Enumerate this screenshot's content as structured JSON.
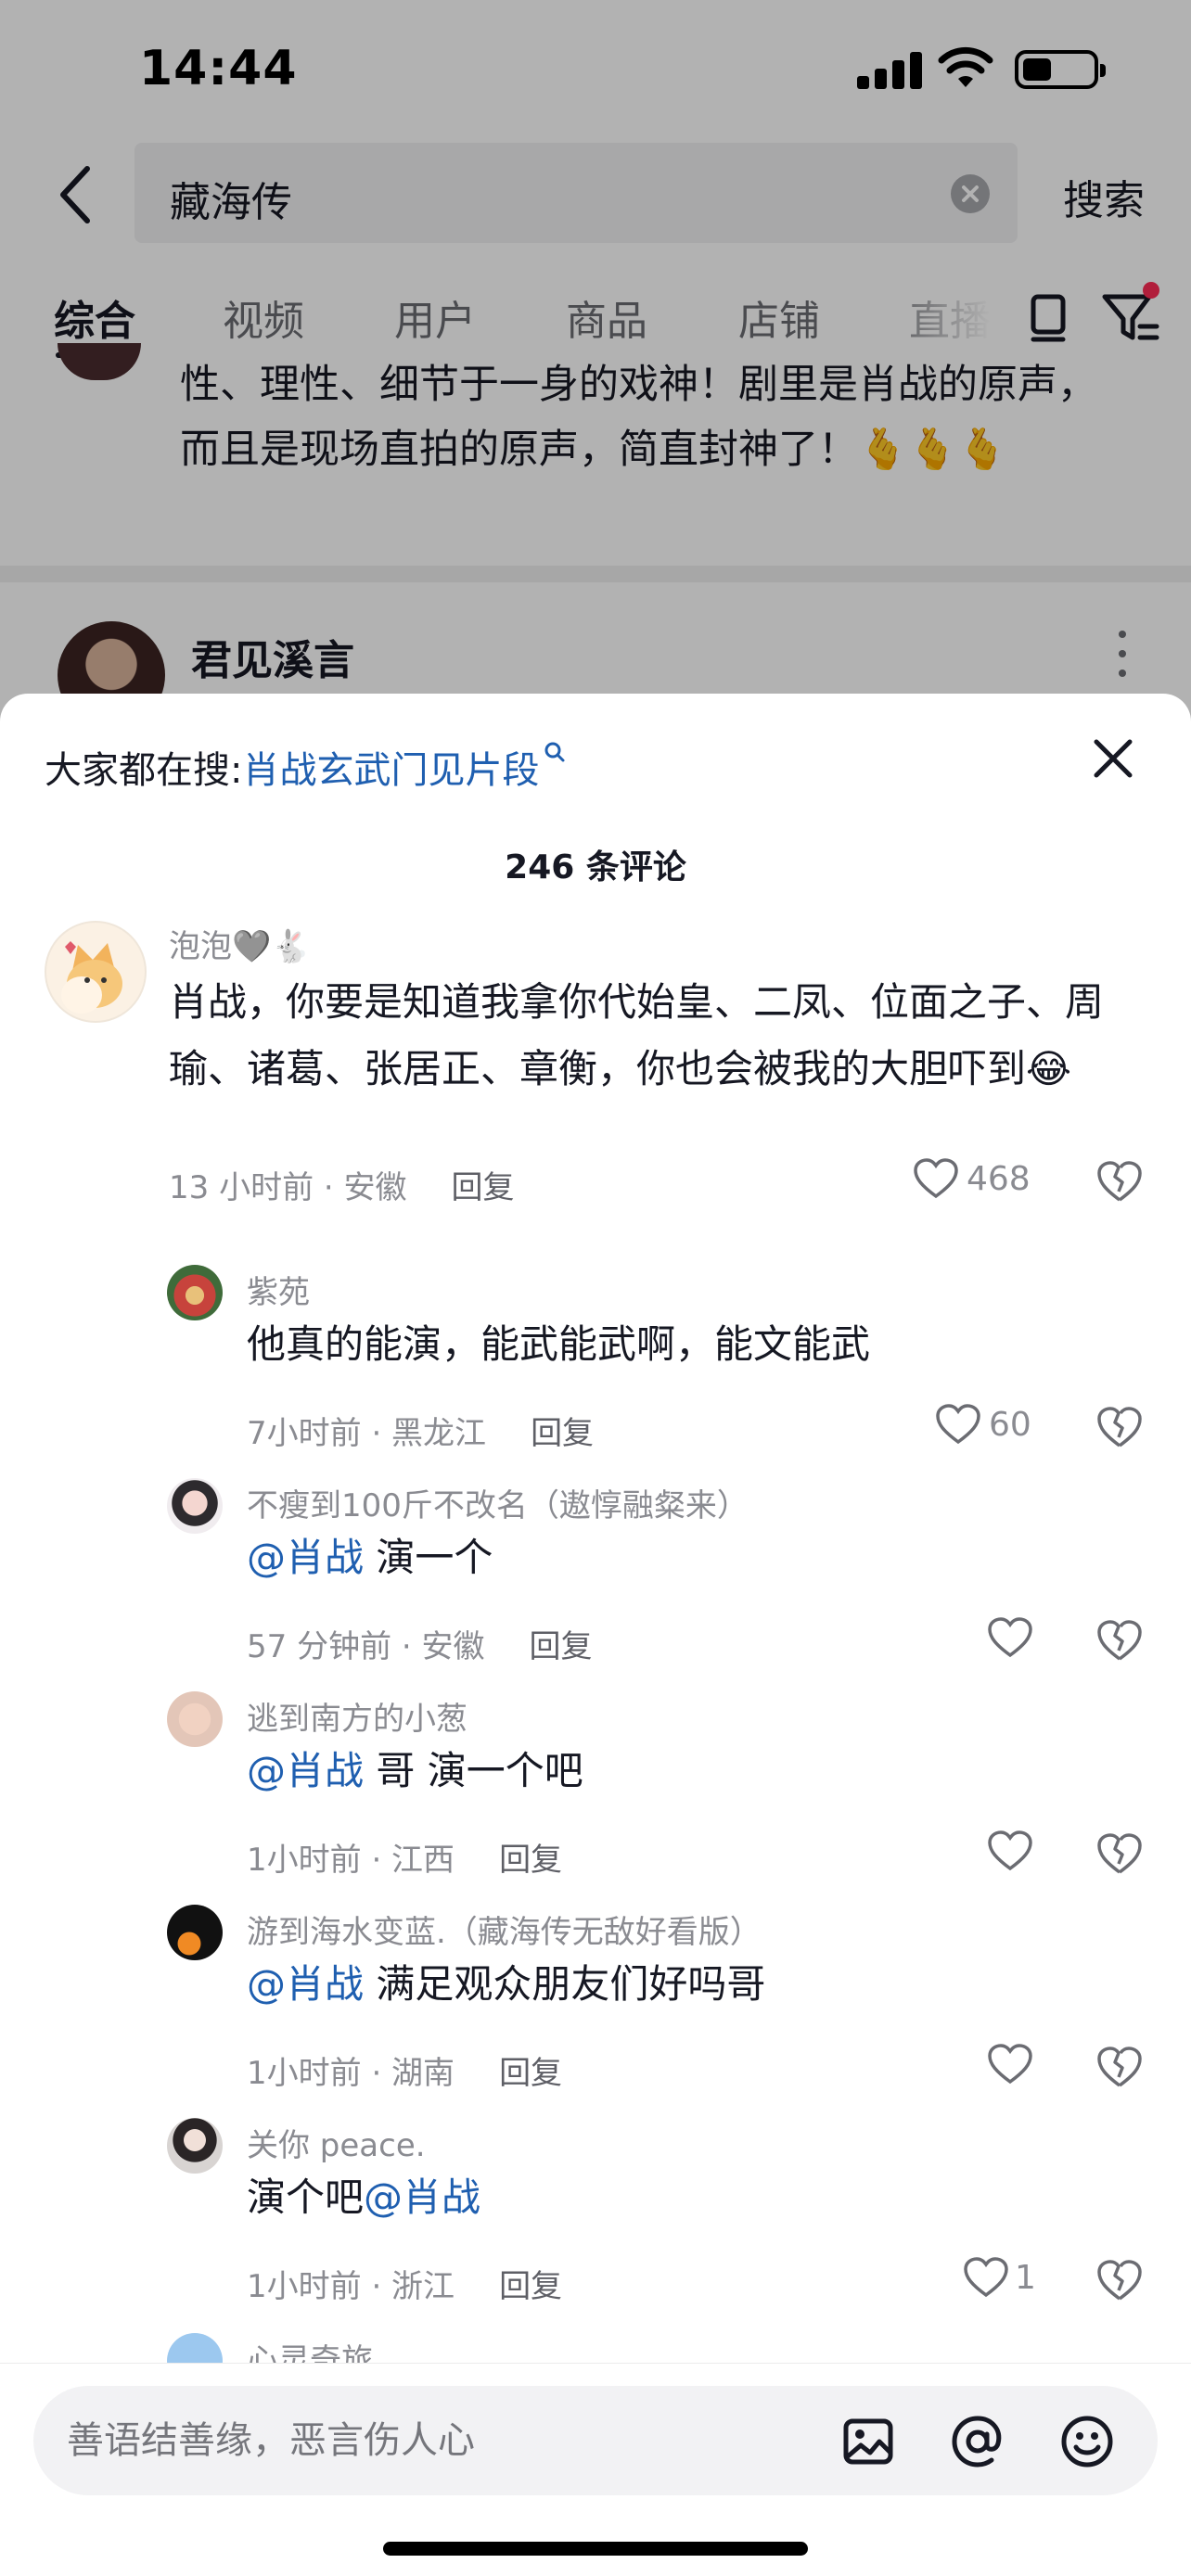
{
  "status_bar": {
    "time": "14:44"
  },
  "search": {
    "query": "藏海传",
    "search_label": "搜索"
  },
  "tabs": [
    {
      "label": "综合",
      "active": true
    },
    {
      "label": "视频"
    },
    {
      "label": "用户"
    },
    {
      "label": "商品"
    },
    {
      "label": "店铺"
    },
    {
      "label": "直播"
    }
  ],
  "result_card": {
    "text_line1": "性、理性、细节于一身的戏神！剧里是肖战的原声，",
    "text_line2": "而且是现场直拍的原声，简直封神了！🫰🫰🫰",
    "author_name": "君见溪言"
  },
  "comment_sheet": {
    "hot_search_prefix": "大家都在搜:",
    "hot_search_keyword": "肖战玄武门见片段",
    "count_title": "246 条评论",
    "reply_label": "回复",
    "comments": [
      {
        "name": "泡泡🩶🐇",
        "text": "肖战，你要是知道我拿你代始皇、二凤、位面之子、周瑜、诸葛、张居正、章衡，你也会被我的大胆吓到😂",
        "meta": "13 小时前 · 安徽",
        "likes": "468"
      },
      {
        "name": "紫苑",
        "text": "他真的能演，能武能武啊，能文能武",
        "meta": "7小时前 · 黑龙江",
        "likes": "60"
      },
      {
        "name": "不瘦到100斤不改名（遨惇融粲来）",
        "mention": "@肖战",
        "text": " 演一个",
        "meta": "57 分钟前 · 安徽",
        "likes": ""
      },
      {
        "name": "逃到南方的小葱",
        "mention": "@肖战",
        "text": " 哥 演一个吧",
        "meta": "1小时前 · 江西",
        "likes": ""
      },
      {
        "name": "游到海水变蓝.（藏海传无敌好看版）",
        "mention": "@肖战",
        "text": " 满足观众朋友们好吗哥",
        "meta": "1小时前 · 湖南",
        "likes": ""
      },
      {
        "name": "关你 peace.",
        "text_before": "演个吧",
        "mention": "@肖战",
        "meta": "1小时前 · 浙江",
        "likes": "1"
      },
      {
        "name": "心灵奇旅"
      }
    ]
  },
  "input": {
    "placeholder": "善语结善缘，恶言伤人心"
  },
  "colors": {
    "mention_blue": "#1f5fb0",
    "accent_red": "#fe2c55"
  }
}
